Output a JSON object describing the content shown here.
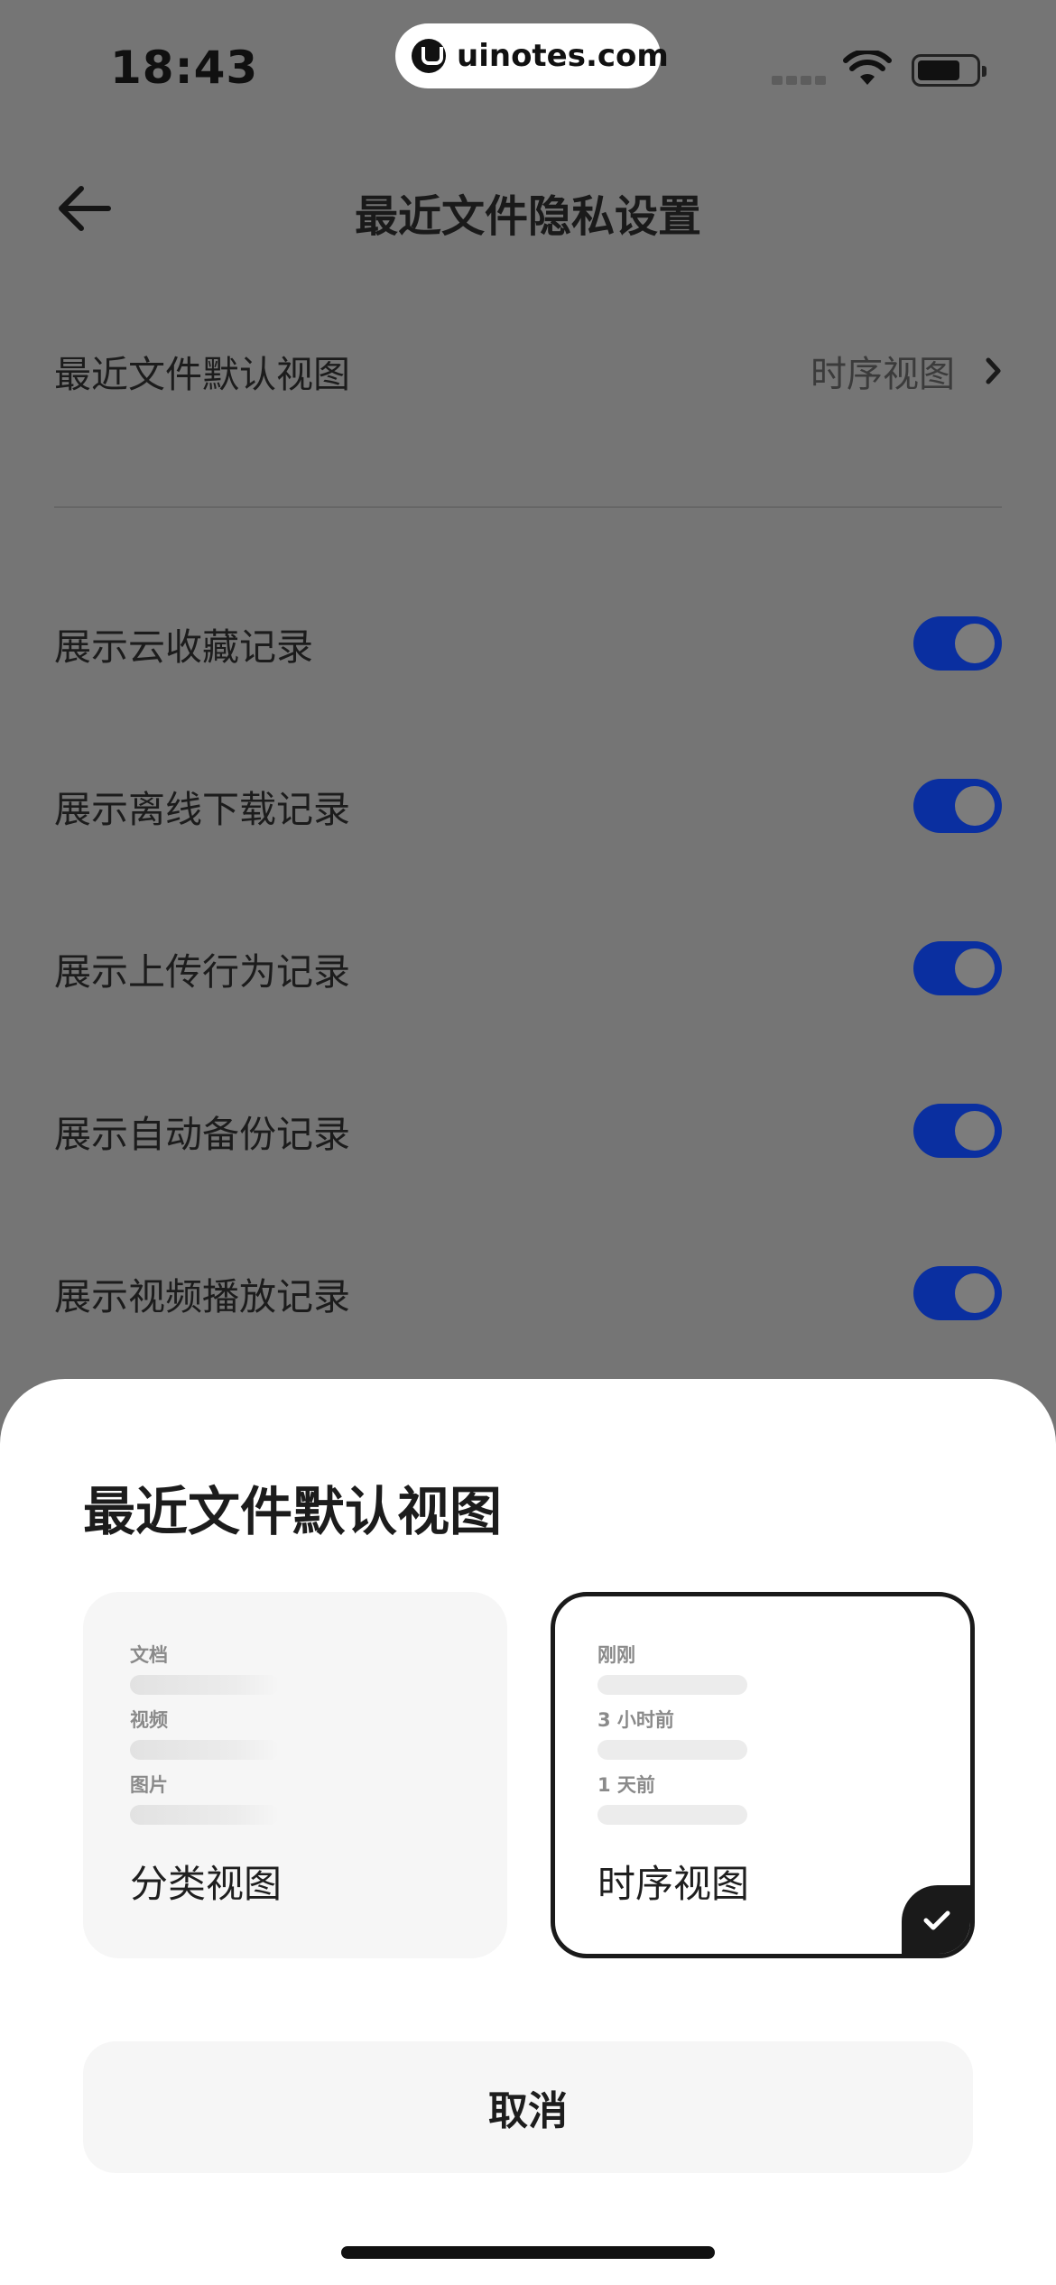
{
  "status_bar": {
    "time": "18:43",
    "watermark": "uinotes.com",
    "icons": [
      "signal-icon",
      "wifi-icon",
      "battery-icon"
    ]
  },
  "nav": {
    "title": "最近文件隐私设置",
    "back_icon": "arrow-left-icon"
  },
  "settings": {
    "default_view": {
      "label": "最近文件默认视图",
      "value": "时序视图"
    },
    "toggles": [
      {
        "label": "展示云收藏记录",
        "on": true
      },
      {
        "label": "展示离线下载记录",
        "on": true
      },
      {
        "label": "展示上传行为记录",
        "on": true
      },
      {
        "label": "展示自动备份记录",
        "on": true
      },
      {
        "label": "展示视频播放记录",
        "on": true
      }
    ]
  },
  "sheet": {
    "title": "最近文件默认视图",
    "options": [
      {
        "name": "分类视图",
        "preview": [
          "文档",
          "视频",
          "图片"
        ],
        "selected": false
      },
      {
        "name": "时序视图",
        "preview": [
          "刚刚",
          "3 小时前",
          "1 天前"
        ],
        "selected": true
      }
    ],
    "cancel_label": "取消"
  },
  "colors": {
    "overlay": "#757575",
    "toggle_on": "#0a2fa0",
    "sheet_bg": "#ffffff",
    "selected_border": "#1a1a1a"
  }
}
